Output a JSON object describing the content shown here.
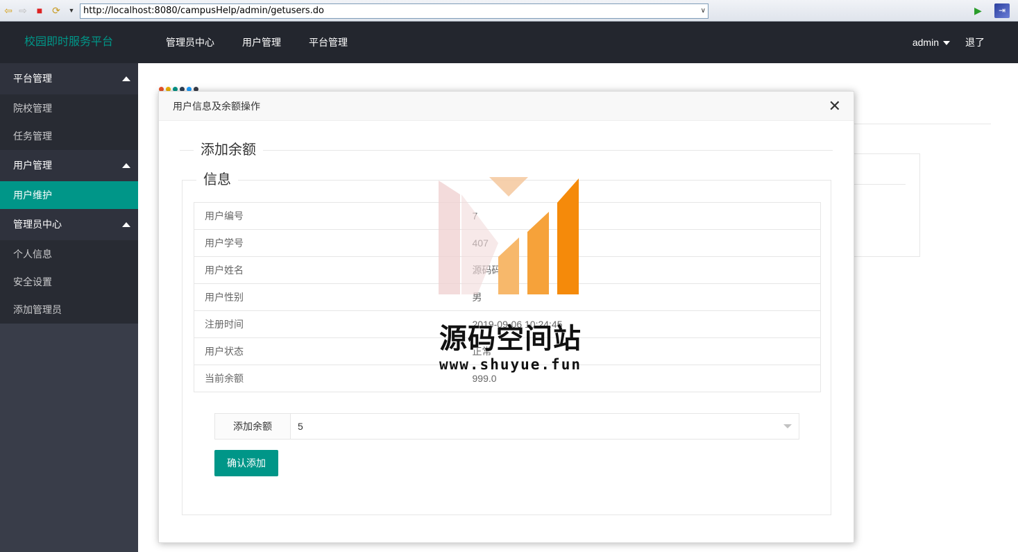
{
  "browser": {
    "url": "http://localhost:8080/campusHelp/admin/getusers.do"
  },
  "header": {
    "logo": "校园即时服务平台",
    "nav": [
      "管理员中心",
      "用户管理",
      "平台管理"
    ],
    "user": "admin",
    "logout": "退了"
  },
  "sidebar": {
    "groups": [
      {
        "label": "平台管理",
        "items": [
          "院校管理",
          "任务管理"
        ]
      },
      {
        "label": "用户管理",
        "items": [
          "用户维护"
        ]
      },
      {
        "label": "管理员中心",
        "items": [
          "个人信息",
          "安全设置",
          "添加管理员"
        ]
      }
    ],
    "active_item": "用户维护"
  },
  "modal": {
    "title": "用户信息及余额操作",
    "section_title": "添加余额",
    "info_legend": "信息",
    "rows": [
      {
        "label": "用户编号",
        "value": "7"
      },
      {
        "label": "用户学号",
        "value": "407"
      },
      {
        "label": "用户姓名",
        "value": "源码码"
      },
      {
        "label": "用户性别",
        "value": "男"
      },
      {
        "label": "注册时间",
        "value": "2019-09-06 10:24:45"
      },
      {
        "label": "用户状态",
        "value": "正常"
      },
      {
        "label": "当前余额",
        "value": "999.0"
      }
    ],
    "form": {
      "label": "添加余额",
      "selected": "5"
    },
    "confirm_button": "确认添加"
  },
  "watermark": {
    "text": "源码空间站",
    "url": "www.shuyue.fun"
  },
  "colors": {
    "accent": "#009688",
    "header_bg": "#23262e",
    "sidebar_bg": "#393d49"
  }
}
